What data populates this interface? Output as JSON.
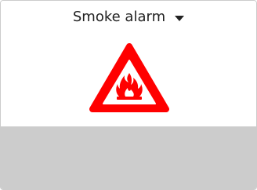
{
  "device": {
    "selected_label": "Smoke alarm",
    "dropdown_icon": "caret-down-icon",
    "status_icon": "fire-warning-icon",
    "colors": {
      "warning_red": "#ff0000",
      "panel_gray": "#cccccc",
      "text": "#222222"
    }
  }
}
